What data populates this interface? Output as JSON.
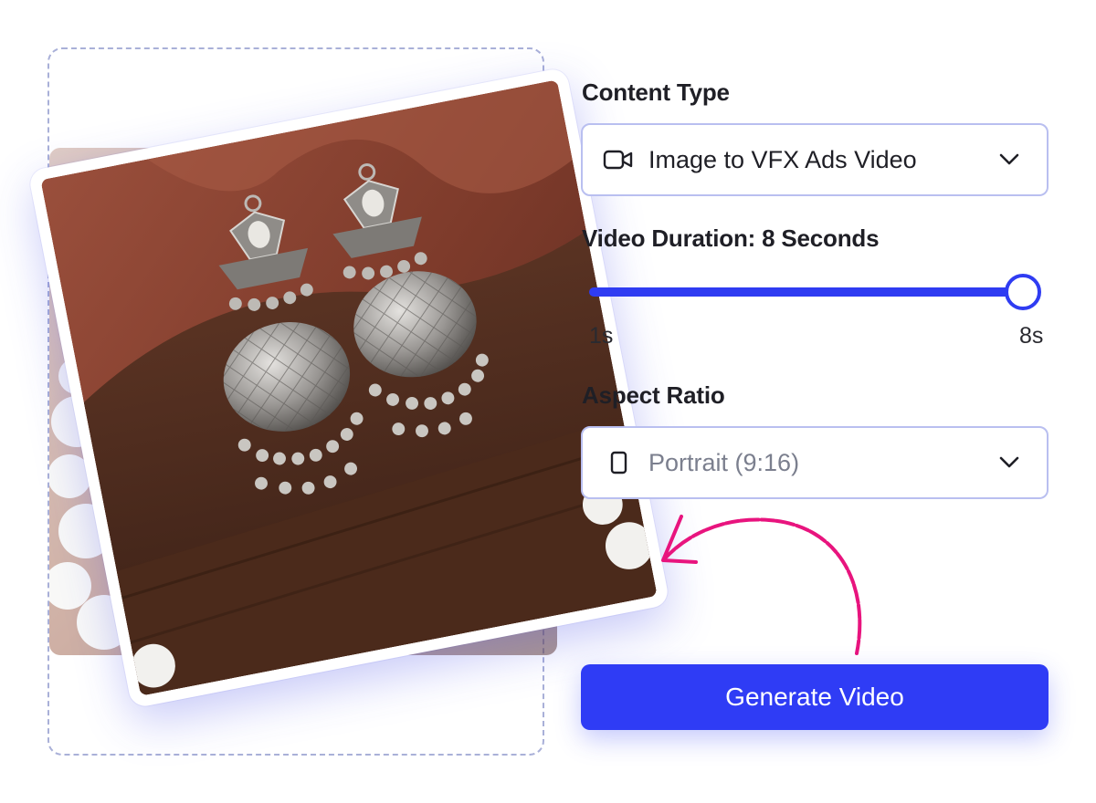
{
  "content_type": {
    "label": "Content Type",
    "value": "Image to VFX Ads Video",
    "icon": "video-camera-icon"
  },
  "duration": {
    "label": "Video Duration: 8 Seconds",
    "min_label": "1s",
    "max_label": "8s",
    "value": 8,
    "min": 1,
    "max": 8
  },
  "aspect_ratio": {
    "label": "Aspect Ratio",
    "value": "Portrait (9:16)",
    "icon": "portrait-frame-icon"
  },
  "generate_button": {
    "label": "Generate Video"
  },
  "colors": {
    "accent": "#2f3cf2",
    "arrow": "#e8147e",
    "border": "#b9bff0"
  }
}
